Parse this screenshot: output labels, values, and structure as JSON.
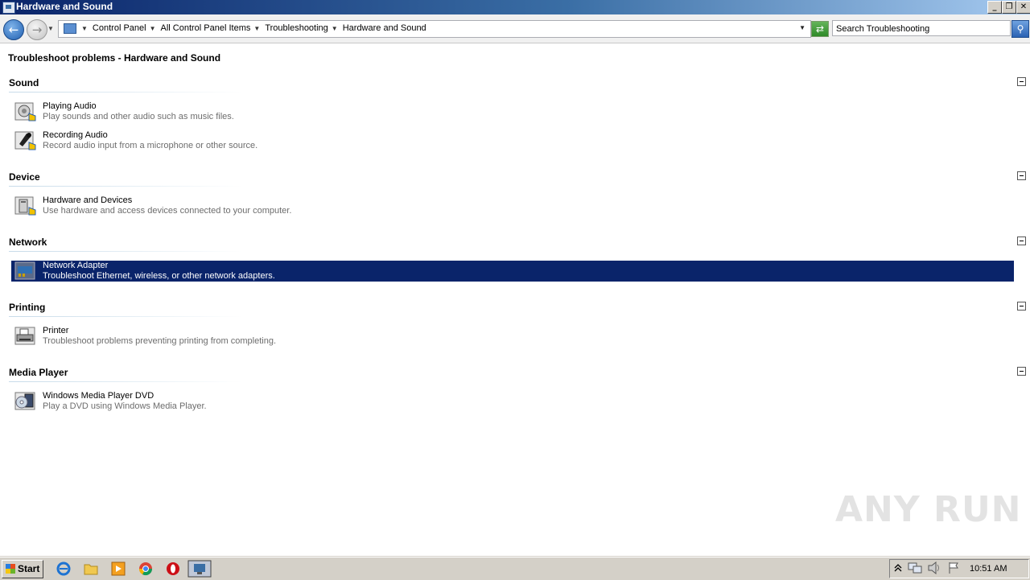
{
  "window": {
    "title": "Hardware and Sound"
  },
  "window_buttons": {
    "minimize": "_",
    "restore": "❐",
    "close": "✕"
  },
  "address": {
    "breadcrumbs": [
      "Control Panel",
      "All Control Panel Items",
      "Troubleshooting",
      "Hardware and Sound"
    ],
    "search_placeholder": "Search Troubleshooting"
  },
  "page": {
    "title": "Troubleshoot problems - Hardware and Sound",
    "groups": [
      {
        "name": "Sound",
        "items": [
          {
            "name": "Playing Audio",
            "desc": "Play sounds and other audio such as music files.",
            "icon": "speaker-icon"
          },
          {
            "name": "Recording Audio",
            "desc": "Record audio input from a microphone or other source.",
            "icon": "microphone-icon"
          }
        ]
      },
      {
        "name": "Device",
        "items": [
          {
            "name": "Hardware and Devices",
            "desc": "Use hardware and access devices connected to your computer.",
            "icon": "hardware-icon"
          }
        ]
      },
      {
        "name": "Network",
        "items": [
          {
            "name": "Network Adapter",
            "desc": "Troubleshoot Ethernet, wireless, or other network adapters.",
            "icon": "network-adapter-icon",
            "selected": true
          }
        ]
      },
      {
        "name": "Printing",
        "items": [
          {
            "name": "Printer",
            "desc": "Troubleshoot problems preventing printing from completing.",
            "icon": "printer-icon"
          }
        ]
      },
      {
        "name": "Media Player",
        "items": [
          {
            "name": "Windows Media Player DVD",
            "desc": "Play a DVD using Windows Media Player.",
            "icon": "dvd-icon"
          }
        ]
      }
    ]
  },
  "watermark": "ANY RUN",
  "taskbar": {
    "start_label": "Start",
    "quick_launch": [
      "internet-explorer-icon",
      "folder-icon",
      "media-player-icon",
      "chrome-icon",
      "opera-icon",
      "control-panel-icon"
    ],
    "clock": "10:51 AM"
  },
  "colors": {
    "selection": "#0a246a",
    "titlebar": "#0a246a",
    "desc_text": "#6d6d6d"
  }
}
